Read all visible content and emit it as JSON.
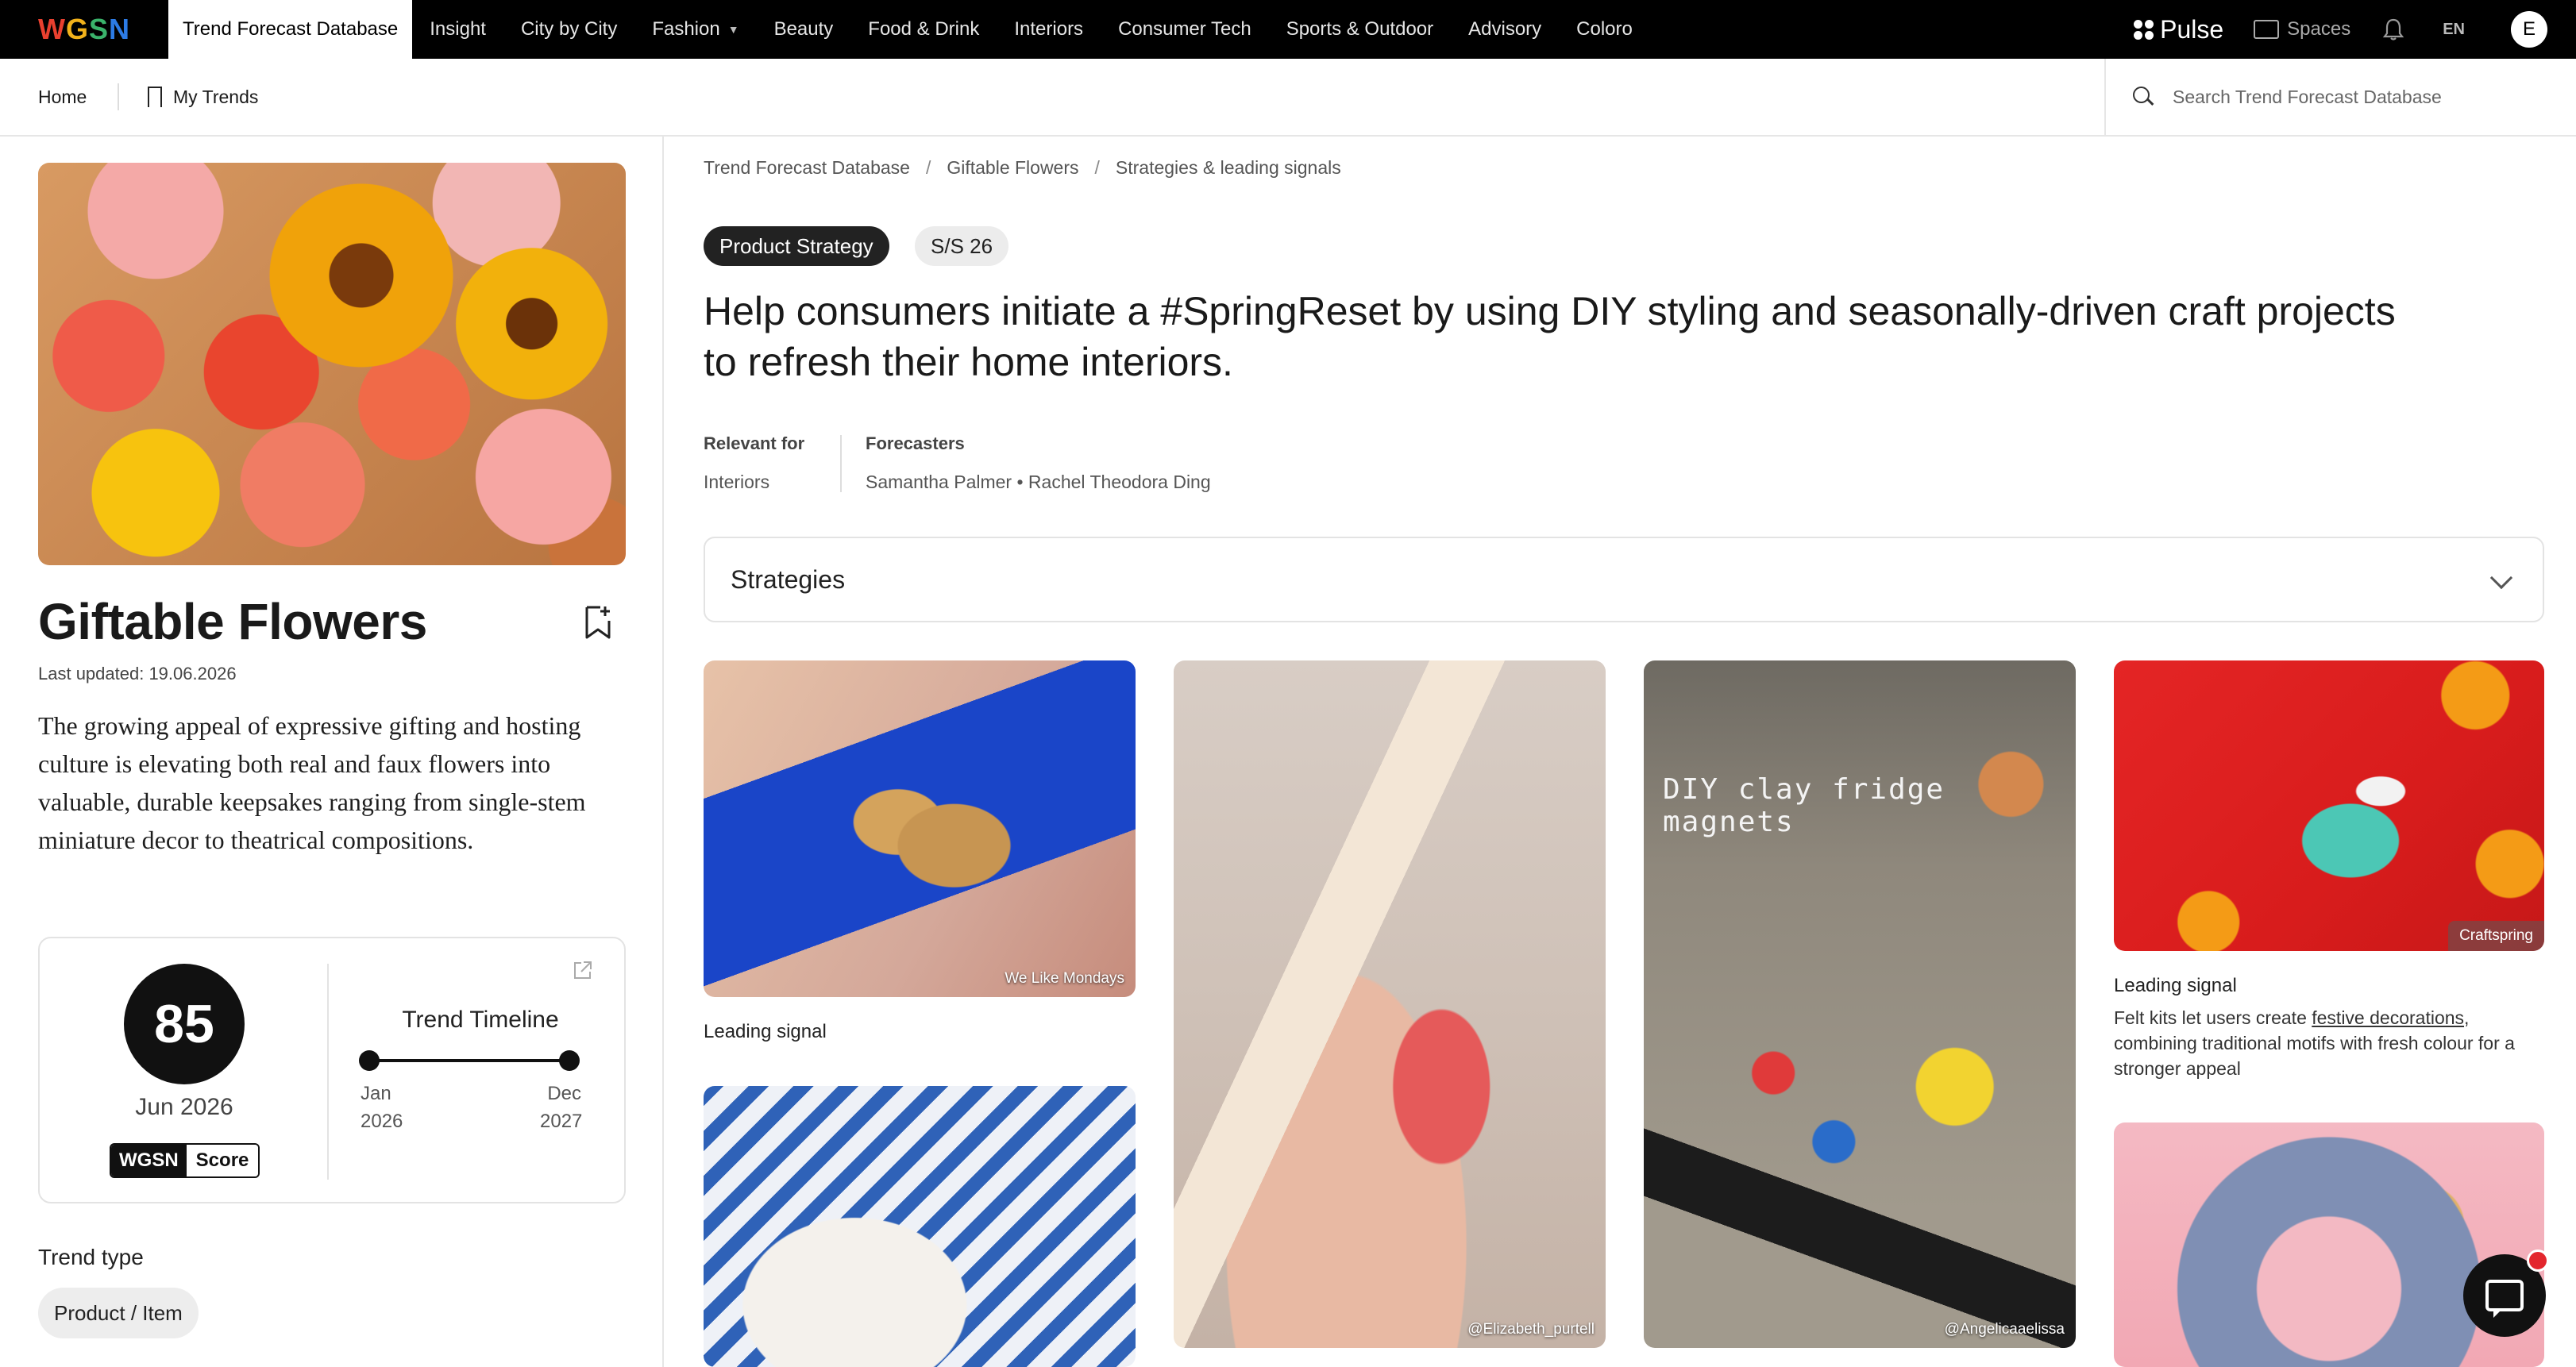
{
  "brand": {
    "logo_letters": [
      "W",
      "G",
      "S",
      "N"
    ],
    "logo_colors": [
      "#e8402f",
      "#f2b21b",
      "#3ab36b",
      "#2c7be5"
    ]
  },
  "topnav": {
    "tabs": [
      {
        "label": "Trend Forecast Database",
        "active": true
      },
      {
        "label": "Insight"
      },
      {
        "label": "City by City"
      },
      {
        "label": "Fashion",
        "has_dropdown": true
      },
      {
        "label": "Beauty"
      },
      {
        "label": "Food & Drink"
      },
      {
        "label": "Interiors"
      },
      {
        "label": "Consumer Tech"
      },
      {
        "label": "Sports & Outdoor"
      },
      {
        "label": "Advisory"
      },
      {
        "label": "Coloro"
      }
    ],
    "pulse_label": "Pulse",
    "spaces_label": "Spaces",
    "lang": "EN",
    "avatar_initial": "E",
    "icons": [
      "pulse-icon",
      "folder-icon",
      "bell-icon"
    ]
  },
  "subnav": {
    "home": "Home",
    "my_trends": "My Trends",
    "search_placeholder": "Search Trend Forecast Database"
  },
  "trend": {
    "title": "Giftable Flowers",
    "last_updated": "Last updated: 19.06.2026",
    "description": "The growing appeal of expressive gifting and hosting culture is elevating both real and faux flowers into valuable, durable keepsakes ranging from single-stem miniature decor to theatrical compositions.",
    "score": "85",
    "score_date": "Jun 2026",
    "score_badge": [
      "WGSN",
      "Score"
    ],
    "timeline": {
      "title": "Trend Timeline",
      "start_month": "Jan",
      "start_year": "2026",
      "end_month": "Dec",
      "end_year": "2027"
    },
    "trend_type_label": "Trend type",
    "trend_type_value": "Product / Item"
  },
  "main": {
    "breadcrumb": [
      "Trend Forecast Database",
      "Giftable Flowers",
      "Strategies & leading signals"
    ],
    "breadcrumb_sep": "/",
    "tags": [
      "Product Strategy",
      "S/S 26"
    ],
    "headline": "Help consumers initiate a #SpringReset by using DIY styling and seasonally-driven craft projects to refresh their home interiors.",
    "relevant_label": "Relevant for",
    "relevant_value": "Interiors",
    "forecasters_label": "Forecasters",
    "forecasters_value": "Samantha Palmer • Rachel Theodora Ding",
    "strategies_label": "Strategies"
  },
  "cards": [
    {
      "credit": "We Like Mondays",
      "caption_title": "Leading signal"
    },
    {
      "credit": ""
    },
    {
      "credit": "@Elizabeth_purtell"
    },
    {
      "credit": "@Angelicaaelissa",
      "overlay_text": "DIY clay fridge magnets"
    },
    {
      "credit": "Craftspring",
      "caption_title": "Leading signal",
      "caption_pre": "Felt kits let users create ",
      "caption_link": "festive decorations",
      "caption_post": ", combining traditional motifs with fresh colour for a stronger appeal"
    },
    {
      "credit": ""
    }
  ]
}
